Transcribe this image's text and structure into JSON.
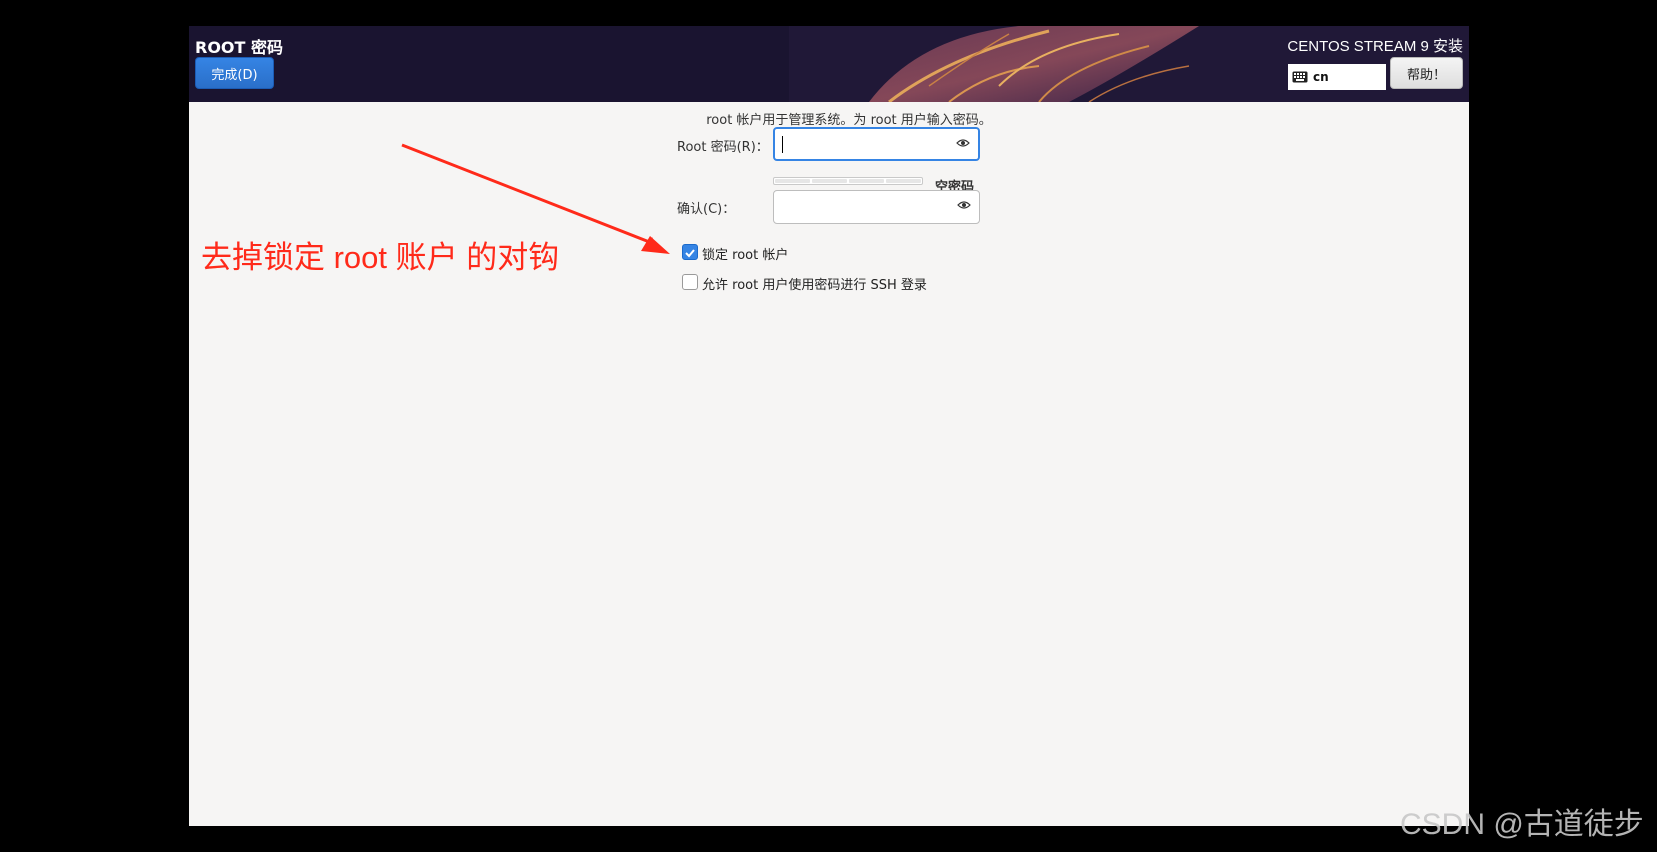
{
  "header": {
    "title": "ROOT 密码",
    "done_label": "完成(D)",
    "product": "CENTOS STREAM 9 安装",
    "keyboard_layout": "cn",
    "help_label": "帮助！"
  },
  "form": {
    "intro": "root 帐户用于管理系统。为 root 用户输入密码。",
    "password_label": "Root 密码(R)：",
    "password_value": "",
    "strength_text": "空密码",
    "strength_level": 0,
    "confirm_label": "确认(C)：",
    "confirm_value": "",
    "lock_root_label": "锁定 root 帐户",
    "lock_root_checked": true,
    "allow_ssh_label": "允许 root 用户使用密码进行 SSH 登录",
    "allow_ssh_checked": false
  },
  "annotation": {
    "text": "去掉锁定 root 账户 的对钩",
    "color": "#ff2a1a"
  },
  "watermark": "CSDN @古道徒步",
  "colors": {
    "accent": "#3584e4",
    "header_bg": "#1d1733",
    "content_bg": "#f6f5f4"
  }
}
